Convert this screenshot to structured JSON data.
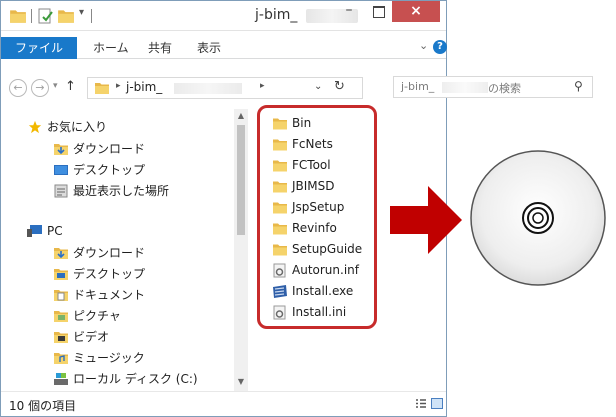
{
  "window": {
    "title": "j-bim_",
    "minimize": "–",
    "close": "×"
  },
  "ribbon": {
    "tabs": [
      "ファイル",
      "ホーム",
      "共有",
      "表示"
    ],
    "help": "?"
  },
  "address": {
    "path_root": "j-bim_",
    "search_placeholder_prefix": "j-bim_",
    "search_placeholder_suffix": "の検索"
  },
  "nav_pane": {
    "favorites_label": "お気に入り",
    "favorites": [
      "ダウンロード",
      "デスクトップ",
      "最近表示した場所"
    ],
    "pc_label": "PC",
    "pc_items": [
      "ダウンロード",
      "デスクトップ",
      "ドキュメント",
      "ピクチャ",
      "ビデオ",
      "ミュージック",
      "ローカル ディスク (C:)"
    ]
  },
  "files": [
    {
      "name": "Bin",
      "icon": "folder-icon"
    },
    {
      "name": "FcNets",
      "icon": "folder-icon"
    },
    {
      "name": "FCTool",
      "icon": "folder-icon"
    },
    {
      "name": "JBIMSD",
      "icon": "folder-icon"
    },
    {
      "name": "JspSetup",
      "icon": "folder-icon"
    },
    {
      "name": "Revinfo",
      "icon": "folder-icon"
    },
    {
      "name": "SetupGuide",
      "icon": "folder-icon"
    },
    {
      "name": "Autorun.inf",
      "icon": "settings-file-icon"
    },
    {
      "name": "Install.exe",
      "icon": "installer-icon"
    },
    {
      "name": "Install.ini",
      "icon": "settings-file-icon"
    }
  ],
  "status": {
    "item_count": "10 個の項目"
  },
  "colors": {
    "accent": "#1979ca",
    "highlight_border": "#c72b2b",
    "arrow": "#c00000",
    "close_button": "#c75050"
  }
}
